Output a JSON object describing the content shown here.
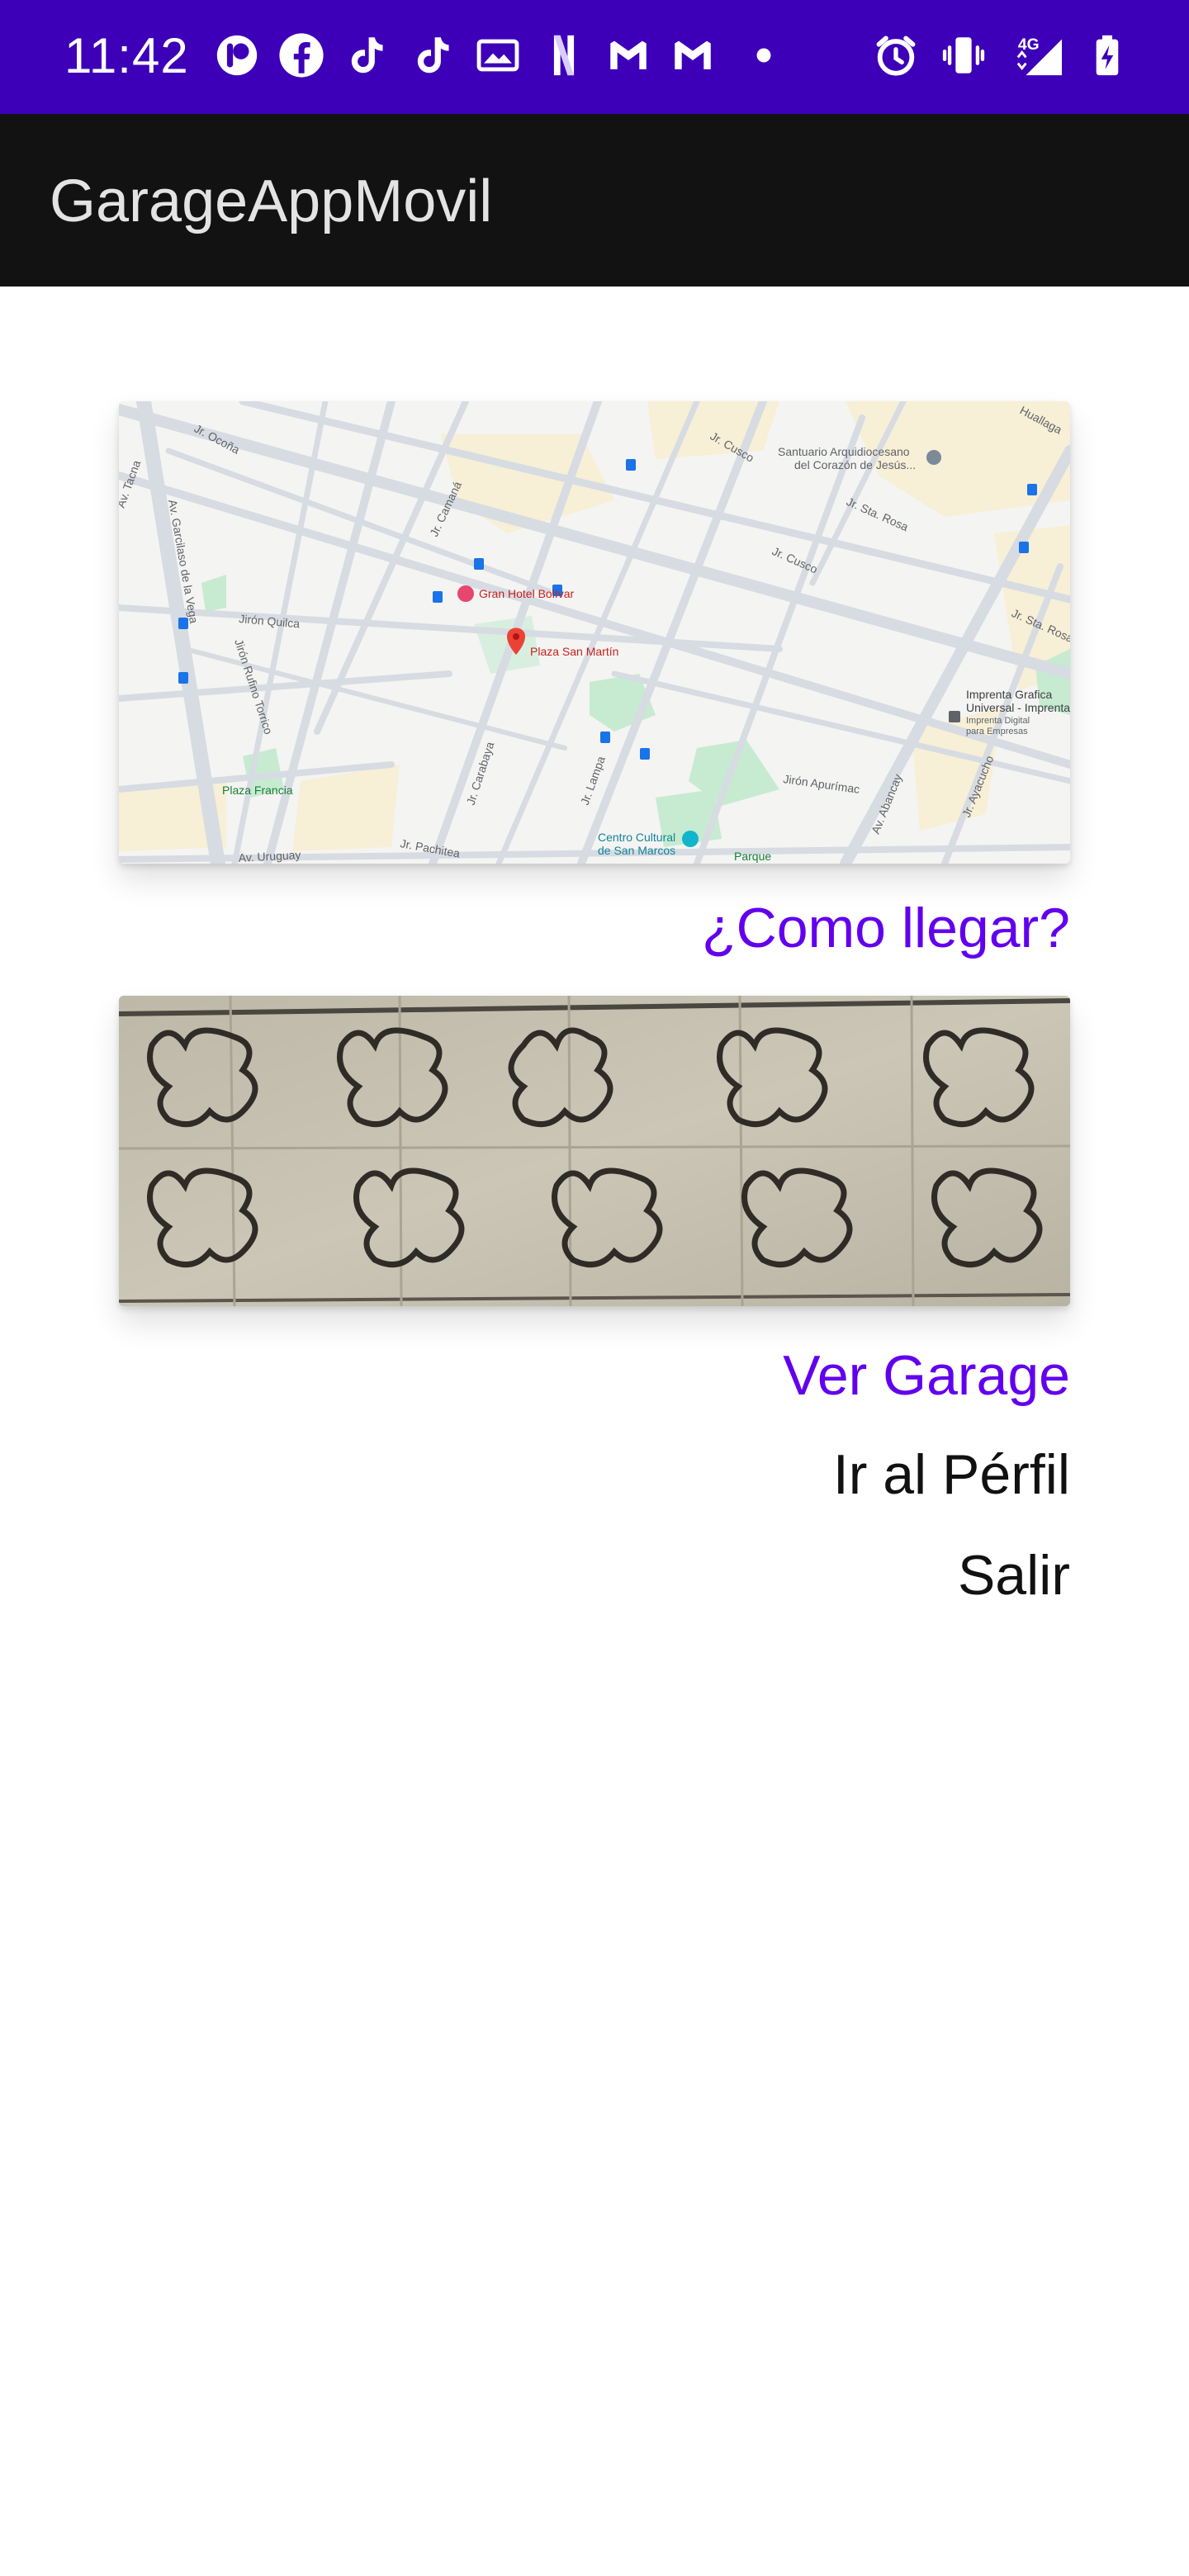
{
  "status_bar": {
    "time": "11:42",
    "network_label": "4G",
    "background_color": "#3d00b8",
    "left_icons": [
      "timer-app-icon",
      "facebook-icon",
      "tiktok-icon",
      "tiktok-icon",
      "gallery-icon",
      "netflix-icon",
      "gmail-icon",
      "gmail-icon",
      "dot-icon"
    ],
    "right_icons": [
      "alarm-icon",
      "vibrate-icon",
      "signal-4g-icon",
      "battery-charging-icon"
    ]
  },
  "app_bar": {
    "title": "GarageAppMovil",
    "background_color": "#121212"
  },
  "map": {
    "streets": [
      "Jr. Ocoña",
      "Av. Tacna",
      "Av. Garcilaso de la Vega",
      "Jirón Quilca",
      "Jr. Camaná",
      "Jirón Rufino Torrico",
      "Jr. Carabaya",
      "Jr. Lampa",
      "Jr. Cusco",
      "Jr. Sta. Rosa",
      "Jirón Apurímac",
      "Av. Abancay",
      "Jr. Ayacucho",
      "Av. Uruguay",
      "Jr. Pachitea",
      "Huallaga"
    ],
    "places": {
      "hotel": "Gran Hotel Bolívar",
      "plaza": "Plaza San Martín",
      "plaza_francia": "Plaza Francia",
      "santuario_line1": "Santuario Arquidiocesano",
      "santuario_line2": "del Corazón de Jesús...",
      "imprenta_line1": "Imprenta Grafica",
      "imprenta_line2": "Universal - Imprenta en...",
      "imprenta_line3": "Imprenta Digital",
      "imprenta_line4": "para Empresas",
      "centro_line1": "Centro Cultural",
      "centro_line2": "de San Marcos",
      "parque": "Parque"
    }
  },
  "actions": {
    "como_llegar": "¿Como llegar?",
    "ver_garage": "Ver Garage",
    "ir_perfil": "Ir al Pérfil",
    "salir": "Salir"
  },
  "colors": {
    "accent": "#6200ee",
    "text_primary": "#111111"
  }
}
